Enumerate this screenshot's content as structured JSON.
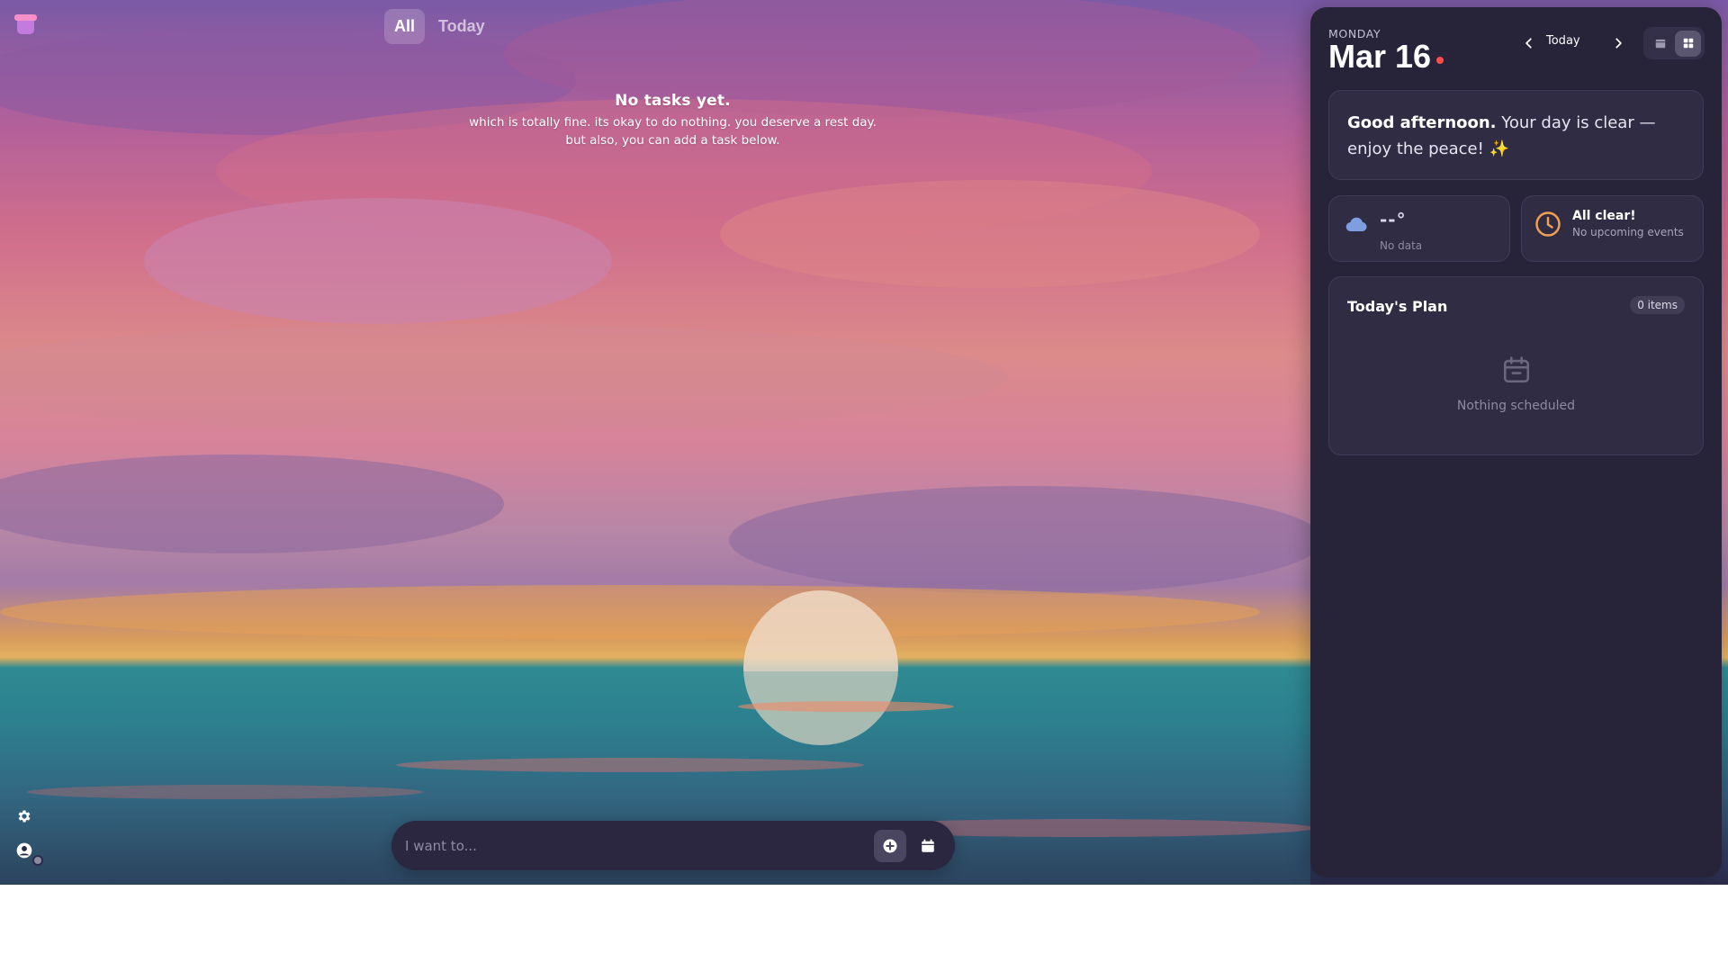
{
  "tabs": [
    {
      "label": "All",
      "active": true
    },
    {
      "label": "Today",
      "active": false
    }
  ],
  "empty_state": {
    "title": "No tasks yet.",
    "line1": "which is totally fine. its okay to do nothing. you deserve a rest day.",
    "line2": "but also, you can add a task below."
  },
  "input": {
    "placeholder": "I want to..."
  },
  "panel": {
    "weekday": "MONDAY",
    "date": "Mar 16",
    "nav_today": "Today",
    "greeting_bold": "Good afternoon.",
    "greeting_rest": " Your day is clear — enjoy the peace! ✨",
    "weather": {
      "temp": "--°",
      "status": "No data"
    },
    "events": {
      "title": "All clear!",
      "subtitle": "No upcoming events"
    },
    "plan": {
      "title": "Today's Plan",
      "count": "0 items",
      "empty": "Nothing scheduled"
    }
  },
  "colors": {
    "accent_dot": "#ff4b4b",
    "panel_bg": "#27243a",
    "clock_orange": "#f0a050",
    "cloud_blue": "#7f9ee0"
  },
  "icons": [
    "app-logo-icon",
    "settings-gear-icon",
    "user-avatar-icon",
    "add-circle-icon",
    "calendar-icon",
    "chevron-left-icon",
    "chevron-right-icon",
    "grid-icon",
    "cloud-icon",
    "clock-icon"
  ]
}
